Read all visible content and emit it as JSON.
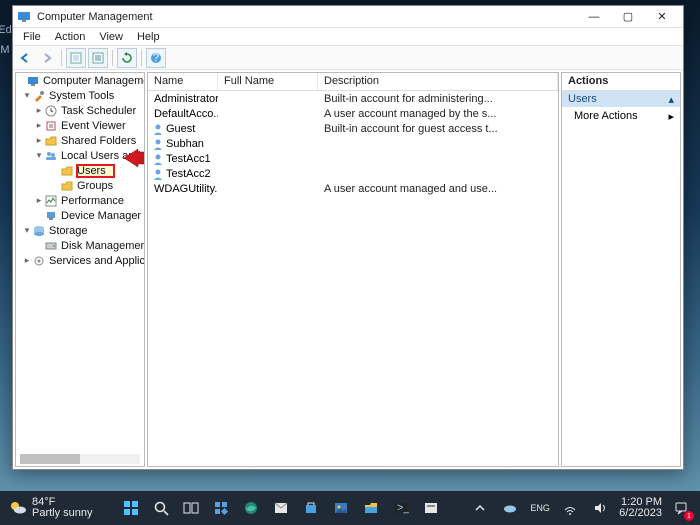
{
  "window": {
    "title": "Computer Management",
    "controls": {
      "min": "—",
      "max": "▢",
      "close": "✕"
    }
  },
  "menubar": [
    "File",
    "Action",
    "View",
    "Help"
  ],
  "tree": {
    "root": "Computer Management (Local",
    "system_tools": "System Tools",
    "items_st": [
      "Task Scheduler",
      "Event Viewer",
      "Shared Folders"
    ],
    "lug": "Local Users and Groups",
    "lug_children": [
      "Users",
      "Groups"
    ],
    "perf": "Performance",
    "devmgr": "Device Manager",
    "storage": "Storage",
    "diskmgmt": "Disk Management",
    "svc": "Services and Applications"
  },
  "list": {
    "cols": {
      "name": "Name",
      "full": "Full Name",
      "desc": "Description"
    },
    "rows": [
      {
        "name": "Administrator",
        "full": "",
        "desc": "Built-in account for administering..."
      },
      {
        "name": "DefaultAcco...",
        "full": "",
        "desc": "A user account managed by the s..."
      },
      {
        "name": "Guest",
        "full": "",
        "desc": "Built-in account for guest access t..."
      },
      {
        "name": "Subhan",
        "full": "",
        "desc": ""
      },
      {
        "name": "TestAcc1",
        "full": "",
        "desc": ""
      },
      {
        "name": "TestAcc2",
        "full": "",
        "desc": ""
      },
      {
        "name": "WDAGUtility...",
        "full": "",
        "desc": "A user account managed and use..."
      }
    ]
  },
  "actions": {
    "header": "Actions",
    "context": "Users",
    "more": "More Actions"
  },
  "taskbar": {
    "weather_temp": "84°F",
    "weather_desc": "Partly sunny",
    "time": "1:20 PM",
    "date": "6/2/2023",
    "notif_count": "1"
  },
  "left_strip": [
    "Ed",
    "M"
  ]
}
